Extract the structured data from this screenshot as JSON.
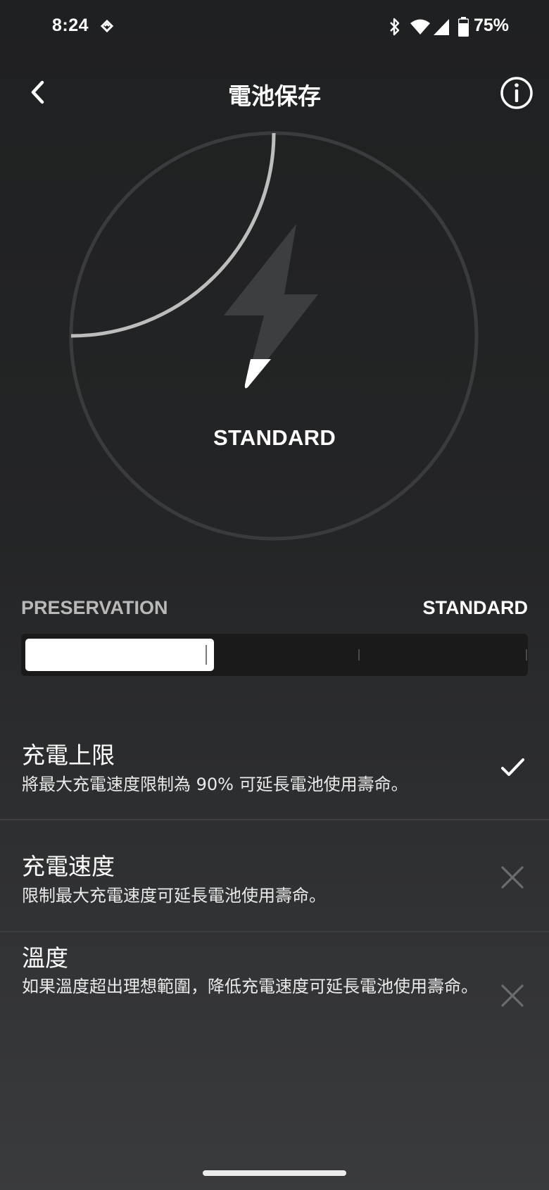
{
  "status_bar": {
    "time": "8:24",
    "battery_percent": "75%",
    "icons": [
      "app-notification-icon",
      "bluetooth-icon",
      "wifi-icon",
      "cell-signal-icon",
      "battery-icon"
    ]
  },
  "header": {
    "title": "電池保存",
    "back_icon": "chevron-left-icon",
    "info_icon": "info-icon"
  },
  "gauge": {
    "mode_label": "STANDARD",
    "icon": "lightning-bolt-icon",
    "progress_fraction": 0.25
  },
  "slider": {
    "left_label": "PRESERVATION",
    "right_label": "STANDARD",
    "position_fraction": 0.38,
    "stops": 4
  },
  "settings": [
    {
      "title": "充電上限",
      "description": "將最大充電速度限制為 90% 可延長電池使用壽命。",
      "status": "enabled",
      "status_icon": "check-icon"
    },
    {
      "title": "充電速度",
      "description": "限制最大充電速度可延長電池使用壽命。",
      "status": "disabled",
      "status_icon": "close-icon"
    },
    {
      "title": "溫度",
      "description": "如果溫度超出理想範圍，降低充電速度可延長電池使用壽命。",
      "status": "disabled",
      "status_icon": "close-icon"
    }
  ],
  "colors": {
    "background_top": "#1f2021",
    "background_bottom": "#3a3b3d",
    "accent": "#ffffff",
    "muted_label": "#b9b9b9",
    "disabled_icon": "#6b6c6e"
  }
}
